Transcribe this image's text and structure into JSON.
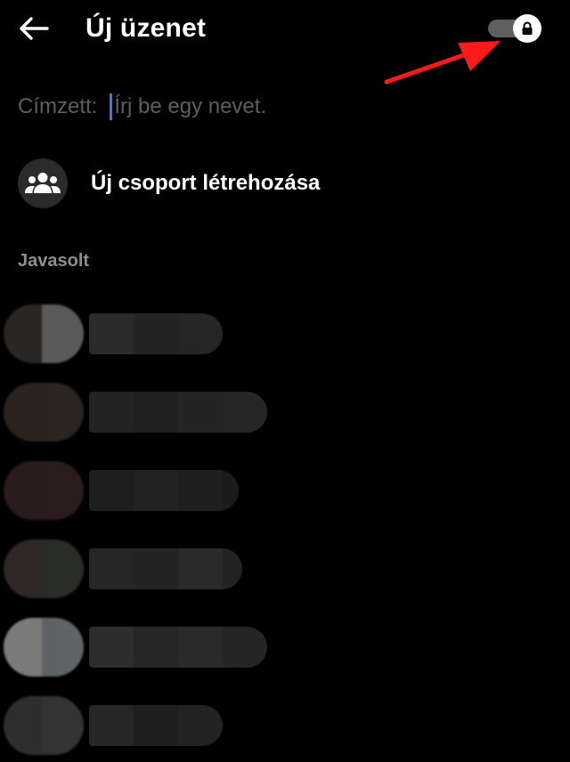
{
  "header": {
    "title": "Új üzenet",
    "back_icon": "arrow-left-icon",
    "toggle_icon": "lock-icon",
    "toggle_on": true,
    "annotation_color": "#ff1a1a"
  },
  "recipient": {
    "label": "Címzett:",
    "placeholder": "Írj be egy nevet.",
    "value": ""
  },
  "new_group": {
    "label": "Új csoport létrehozása",
    "icon": "group-icon"
  },
  "suggested": {
    "heading": "Javasolt"
  },
  "colors": {
    "background": "#000000",
    "toggle_track": "#5f5f5f",
    "caret": "#3a7bd5",
    "muted_text": "#5e5e5e"
  }
}
